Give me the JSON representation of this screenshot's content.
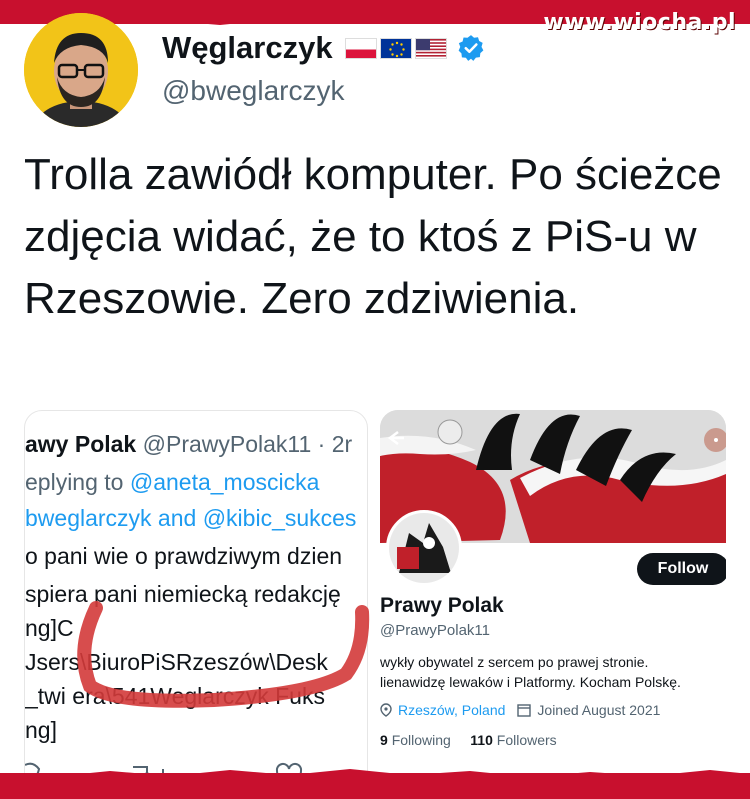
{
  "watermark": "www.wiocha.pl",
  "tweet": {
    "author_name": "Węglarczyk",
    "handle": "@bweglarczyk",
    "text": "Trolla zawiódł komputer. Po ścieżce zdjęcia widać, że to ktoś z PiS-u w Rzeszowie. Zero zdziwienia.",
    "flags": [
      "flag-poland",
      "flag-eu",
      "flag-usa"
    ],
    "verified_icon": "verified-badge-icon"
  },
  "left_card": {
    "lines": [
      {
        "a": "awy Polak ",
        "b": "@PrawyPolak11 · 2r"
      },
      {
        "a": "eplying to ",
        "b": "@aneta_moscicka"
      },
      {
        "a": "bweglarczyk",
        "b": " and ",
        "c": "@kibic_sukces"
      },
      {
        "a": "o pani wie o prawdziwym dzien"
      },
      {
        "a": "spiera pani niemiecką redakcję"
      },
      {
        "a": "ng]C"
      },
      {
        "a": "Jsers\\BiuroPiSRzeszów\\Desk"
      },
      {
        "a": "_twi   era\\541Weglarczyk Fuks"
      },
      {
        "a": "ng]"
      }
    ],
    "icons": [
      "reply-icon",
      "retweet-icon",
      "like-icon"
    ]
  },
  "right_card": {
    "follow_label": "Follow",
    "name": "Prawy Polak",
    "handle": "@PrawyPolak11",
    "bio_line1": "wykły obywatel z sercem po prawej stronie.",
    "bio_line2": "lienawidzę lewaków i Platformy. Kocham Polskę.",
    "location": "Rzeszów, Poland",
    "joined": "Joined August 2021",
    "following_count": "9",
    "following_label": "Following",
    "followers_count": "110",
    "followers_label": "Followers"
  },
  "colors": {
    "band_red": "#c8102e",
    "twitter_blue": "#1d9bf0",
    "avatar_bg": "#f2c418",
    "scribble": "#d33a3a"
  }
}
